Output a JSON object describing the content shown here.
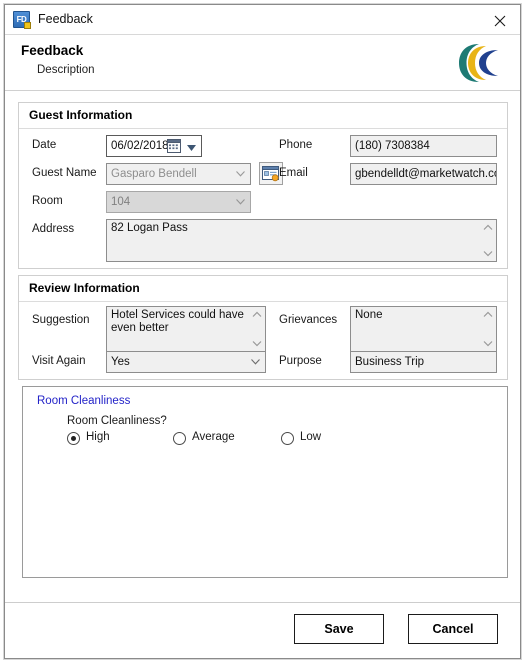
{
  "window": {
    "title": "Feedback",
    "icon": "app-icon-fd",
    "icon_text": "FD",
    "close_icon": "close-icon"
  },
  "header": {
    "title": "Feedback",
    "subtitle": "Description",
    "logo": "crescent-brand-logo",
    "logo_colors": [
      "#1d7a74",
      "#e8b417",
      "#20418f"
    ]
  },
  "guest_information": {
    "legend": "Guest Information",
    "fields": {
      "date": {
        "label": "Date",
        "value": "06/02/2018",
        "icon": "calendar-icon"
      },
      "guest_name": {
        "label": "Guest Name",
        "value": "Gasparo Bendell"
      },
      "room": {
        "label": "Room",
        "value": "104"
      },
      "address": {
        "label": "Address",
        "value": "82 Logan Pass"
      },
      "phone": {
        "label": "Phone",
        "value": "(180) 7308384"
      },
      "email": {
        "label": "Email",
        "value": "gbendelldt@marketwatch.com"
      },
      "guest_lookup": {
        "icon": "guest-lookup-icon"
      }
    }
  },
  "review_information": {
    "legend": "Review Information",
    "fields": {
      "suggestion": {
        "label": "Suggestion",
        "value": "Hotel Services could have even better"
      },
      "grievances": {
        "label": "Grievances",
        "value": "None"
      },
      "visit_again": {
        "label": "Visit Again",
        "value": "Yes"
      },
      "purpose": {
        "label": "Purpose",
        "value": "Business Trip"
      }
    }
  },
  "room_cleanliness": {
    "link_label": "Room Cleanliness",
    "question": "Room Cleanliness?",
    "selected": "High",
    "options": [
      {
        "label": "High",
        "selected": true
      },
      {
        "label": "Average",
        "selected": false
      },
      {
        "label": "Low",
        "selected": false
      }
    ]
  },
  "footer": {
    "save_label": "Save",
    "cancel_label": "Cancel"
  }
}
